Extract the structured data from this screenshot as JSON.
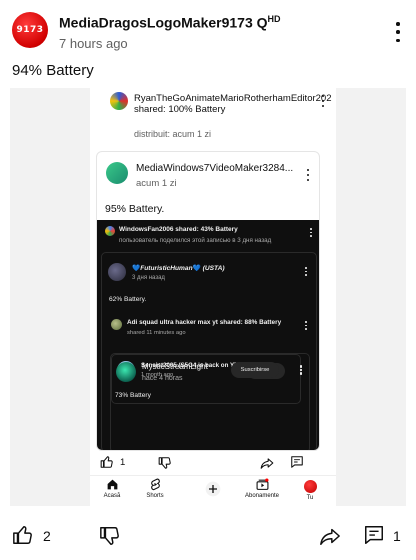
{
  "post": {
    "author": "MediaDragosLogoMaker9173",
    "author_suffix": "Q",
    "author_sup": "HD",
    "avatar_text": "9173",
    "time": "7 hours ago",
    "text": "94% Battery",
    "likes": "2",
    "comments": "1"
  },
  "shot": {
    "level1": {
      "author_line": "RyanTheGoAnimateMarioRotherhamEditor202 shared: 100% Battery",
      "time": "distribuit: acum 1 zi"
    },
    "level2": {
      "author": "MediaWindows7VideoMaker3284...",
      "time": "acum 1 zi",
      "text": "95% Battery.",
      "likes": "1"
    },
    "dark": {
      "row1_title": "WindowsFan2006 shared: 43% Battery",
      "row1_sub": "пользователь поделился этой записью в 3 дня назад",
      "card1_name": "FuturisticHuman",
      "card1_name_suffix": "(USTA)",
      "card1_heart": "💙",
      "card1_time": "3 дня назад",
      "card1_text": "62% Battery.",
      "row2_title": "Adi squad ultra hacker max yt shared: 88% Battery",
      "row2_sub": "shared 11 minutes ago",
      "card2_name": "Sensist2005 (S5G4 is back on YT)",
      "card2_time": "1 month ago",
      "card2_subscribe": "Subscribe",
      "card2_text": "73% Battery",
      "card3_name": "MysticStreamLight",
      "card3_time": "hace 4 horas",
      "card3_subscribe": "Suscribirse"
    },
    "nav": {
      "home": "Acasă",
      "shorts": "Shorts",
      "subs": "Abonamente",
      "you": "Tu"
    }
  },
  "colors": {
    "accent_red": "#ff0000",
    "dark_bg": "#0f0f0f",
    "muted_text": "#606060"
  },
  "icons": [
    "more-vert-icon",
    "thumbs-up-icon",
    "thumbs-down-icon",
    "share-icon",
    "comment-icon",
    "home-icon",
    "shorts-icon",
    "add-icon",
    "subscriptions-icon"
  ]
}
